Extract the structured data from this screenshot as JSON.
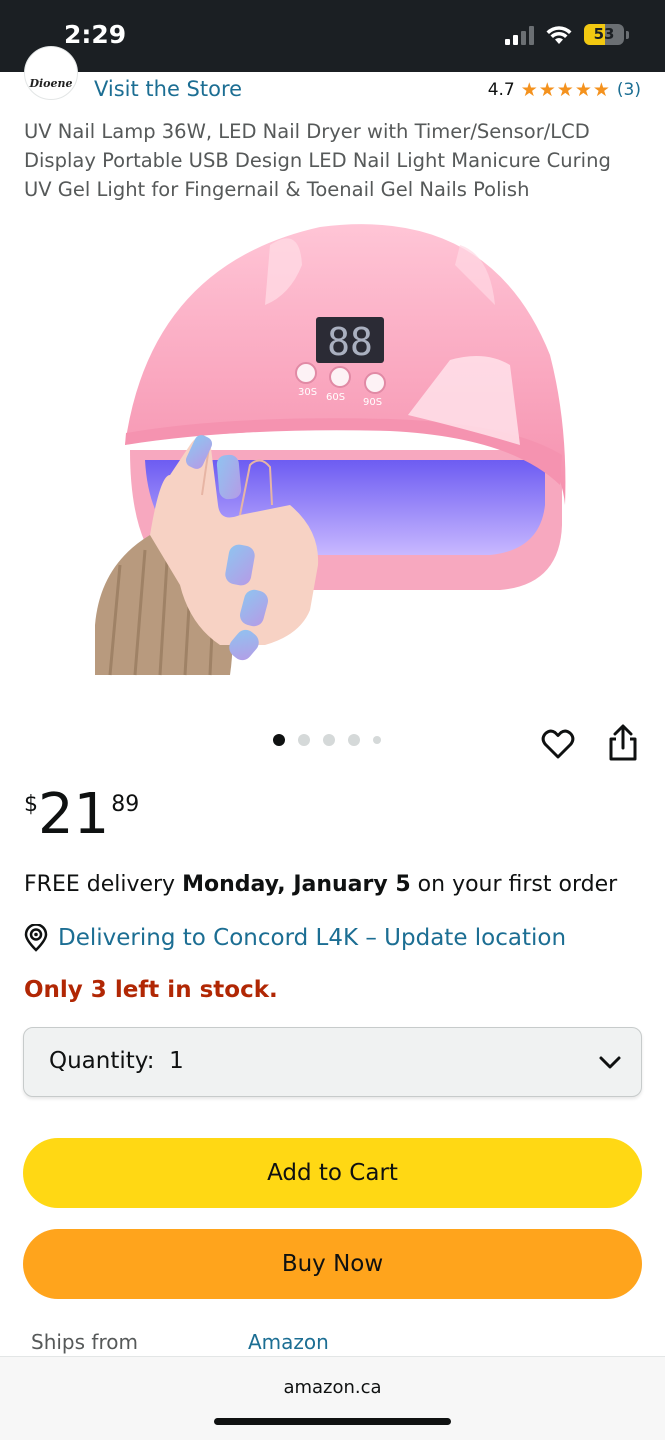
{
  "status_bar": {
    "time": "2:29",
    "battery": "53",
    "battery_level": 0.53
  },
  "store": {
    "logo_text": "Dioene",
    "link": "Visit the Store"
  },
  "rating": {
    "value": "4.7",
    "stars": "★★★★★",
    "stars_value": 4.7,
    "count": "(3)"
  },
  "product": {
    "title": "UV Nail Lamp 36W, LED Nail Dryer with Timer/Sensor/LCD Display Portable USB Design LED Nail Light Manicure Curing UV Gel Light for Fingernail & Toenail Gel Nails Polish",
    "display_digits": "88",
    "timer_labels": [
      "30S",
      "60S",
      "90S"
    ]
  },
  "carousel": {
    "count": 5,
    "active": 0
  },
  "price": {
    "symbol": "$",
    "whole": "21",
    "fraction": "89"
  },
  "delivery": {
    "prefix": "FREE delivery",
    "date": "Monday, January 5",
    "suffix": "on your first order"
  },
  "location": {
    "text": "Delivering to Concord L4K – Update location"
  },
  "stock": {
    "text": "Only 3 left in stock."
  },
  "quantity": {
    "label": "Quantity:  1"
  },
  "buttons": {
    "add_to_cart": "Add to Cart",
    "buy_now": "Buy Now"
  },
  "ships_from": {
    "label": "Ships from",
    "value": "Amazon"
  },
  "browser": {
    "domain": "amazon.ca"
  },
  "colors": {
    "link": "#1c6e93",
    "cart": "#ffd814",
    "buy": "#ffa41c",
    "stock": "#b12704",
    "star": "#f4921e"
  }
}
